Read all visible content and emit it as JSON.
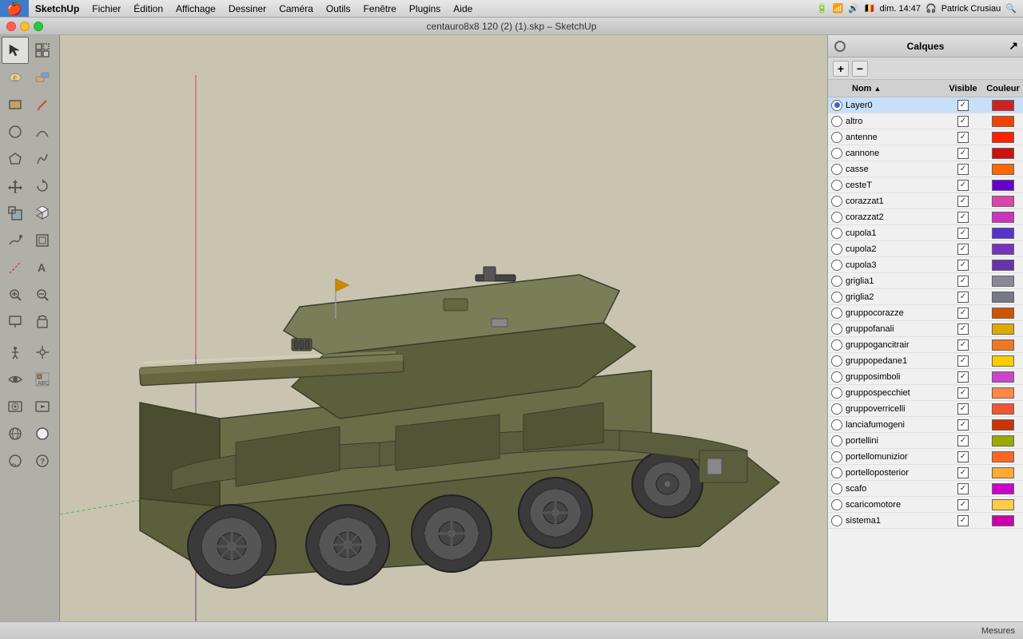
{
  "menubar": {
    "apple": "🍎",
    "items": [
      "SketchUp",
      "Fichier",
      "Édition",
      "Affichage",
      "Dessiner",
      "Caméra",
      "Outils",
      "Fenêtre",
      "Plugins",
      "Aide"
    ],
    "right": {
      "icons": "⬜ 📶 🔊 🇧🇪 dim. 14:47 🎧 Patrick Crusiau 🔍"
    }
  },
  "titlebar": {
    "title": "centauro8x8 120 (2) (1).skp – SketchUp"
  },
  "layers_panel": {
    "title": "Calques",
    "col_nom": "Nom",
    "col_visible": "Visible",
    "col_couleur": "Couleur",
    "layers": [
      {
        "name": "Layer0",
        "visible": true,
        "active": true,
        "color": "#cc2222"
      },
      {
        "name": "altro",
        "visible": true,
        "active": false,
        "color": "#ee4400"
      },
      {
        "name": "antenne",
        "visible": true,
        "active": false,
        "color": "#ff2200"
      },
      {
        "name": "cannone",
        "visible": true,
        "active": false,
        "color": "#cc1111"
      },
      {
        "name": "casse",
        "visible": true,
        "active": false,
        "color": "#ff6600"
      },
      {
        "name": "cesteT",
        "visible": true,
        "active": false,
        "color": "#6600cc"
      },
      {
        "name": "corazzat1",
        "visible": true,
        "active": false,
        "color": "#dd44aa"
      },
      {
        "name": "corazzat2",
        "visible": true,
        "active": false,
        "color": "#cc33bb"
      },
      {
        "name": "cupola1",
        "visible": true,
        "active": false,
        "color": "#5533cc"
      },
      {
        "name": "cupola2",
        "visible": true,
        "active": false,
        "color": "#7733bb"
      },
      {
        "name": "cupola3",
        "visible": true,
        "active": false,
        "color": "#6633aa"
      },
      {
        "name": "griglia1",
        "visible": true,
        "active": false,
        "color": "#888899"
      },
      {
        "name": "griglia2",
        "visible": true,
        "active": false,
        "color": "#777788"
      },
      {
        "name": "gruppocorazze",
        "visible": true,
        "active": false,
        "color": "#cc5500"
      },
      {
        "name": "gruppofanali",
        "visible": true,
        "active": false,
        "color": "#ddaa00"
      },
      {
        "name": "gruppogancitrair",
        "visible": true,
        "active": false,
        "color": "#ee7722"
      },
      {
        "name": "gruppopedane1",
        "visible": true,
        "active": false,
        "color": "#ffcc00"
      },
      {
        "name": "grupposimboli",
        "visible": true,
        "active": false,
        "color": "#cc44cc"
      },
      {
        "name": "gruppospecchiet",
        "visible": true,
        "active": false,
        "color": "#ff8844"
      },
      {
        "name": "gruppoverricelli",
        "visible": true,
        "active": false,
        "color": "#ee5533"
      },
      {
        "name": "lanciafumogeni",
        "visible": true,
        "active": false,
        "color": "#cc3300"
      },
      {
        "name": "portellini",
        "visible": true,
        "active": false,
        "color": "#99aa00"
      },
      {
        "name": "portellomunizior",
        "visible": true,
        "active": false,
        "color": "#ff6622"
      },
      {
        "name": "portelloposterior",
        "visible": true,
        "active": false,
        "color": "#ffaa33"
      },
      {
        "name": "scafo",
        "visible": true,
        "active": false,
        "color": "#cc00cc"
      },
      {
        "name": "scaricomotore",
        "visible": true,
        "active": false,
        "color": "#ffcc44"
      },
      {
        "name": "sistema1",
        "visible": true,
        "active": false,
        "color": "#cc00aa"
      }
    ]
  },
  "statusbar": {
    "text": "Mesures"
  },
  "tools": {
    "rows": [
      [
        "↖",
        "⬛"
      ],
      [
        "✋",
        "📦"
      ],
      [
        "⬜",
        "✏️"
      ],
      [
        "⭕",
        "〜"
      ],
      [
        "🔺",
        "🔄"
      ],
      [
        "🔃",
        "🔃"
      ],
      [
        "✂️",
        "📐"
      ],
      [
        "🖊️",
        "🔍"
      ],
      [
        "🔍+",
        "🔍-"
      ],
      [
        "🔍↕",
        "🔍→"
      ],
      [
        "↻",
        "💡"
      ],
      [
        "👁",
        "📷"
      ],
      [
        "📷",
        "🎬"
      ],
      [
        "⬜",
        "🌍"
      ],
      [
        "🌙",
        "❓"
      ]
    ]
  }
}
